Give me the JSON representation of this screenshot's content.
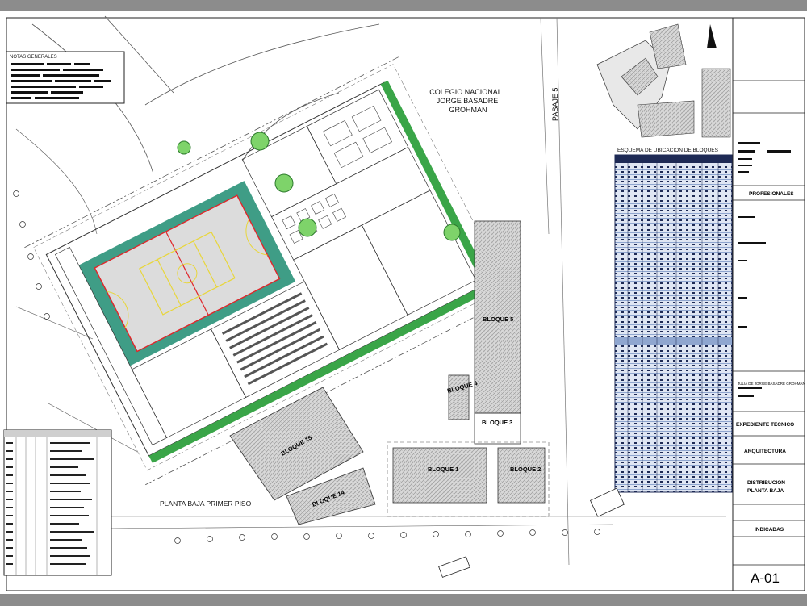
{
  "drawing": {
    "neighbor_label_lines": [
      "COLEGIO NACIONAL",
      "JORGE BASADRE",
      "GROHMAN"
    ],
    "street_label": "PASAJE 5",
    "notes_title": "NOTAS GENERALES",
    "blocks": [
      "BLOQUE 5",
      "BLOQUE 4",
      "BLOQUE 3",
      "BLOQUE 15",
      "BLOQUE 1",
      "BLOQUE 2",
      "BLOQUE 14"
    ],
    "floor_label": "PLANTA BAJA PRIMER PISO",
    "location_schema_title": "ESQUEMA DE UBICACION DE BLOQUES"
  },
  "title_block": {
    "professionals": "PROFESIONALES",
    "owner": "JULIA DE JORGE BASADRE GROHMAN",
    "project_type": "EXPEDIENTE TECNICO",
    "specialty": "ARQUITECTURA",
    "plan_title_lines": [
      "DISTRIBUCION",
      "PLANTA BAJA"
    ],
    "scale": "INDICADAS",
    "sheet_number": "A-01"
  },
  "colors": {
    "court_green": "#3f9d86",
    "grass_green": "#3aa548",
    "court_line_red": "#e0262a",
    "court_line_yellow": "#e8d63a",
    "table_blue": "#8fa6cf",
    "table_dark": "#1e2a55",
    "sheet_border": "#222222"
  }
}
